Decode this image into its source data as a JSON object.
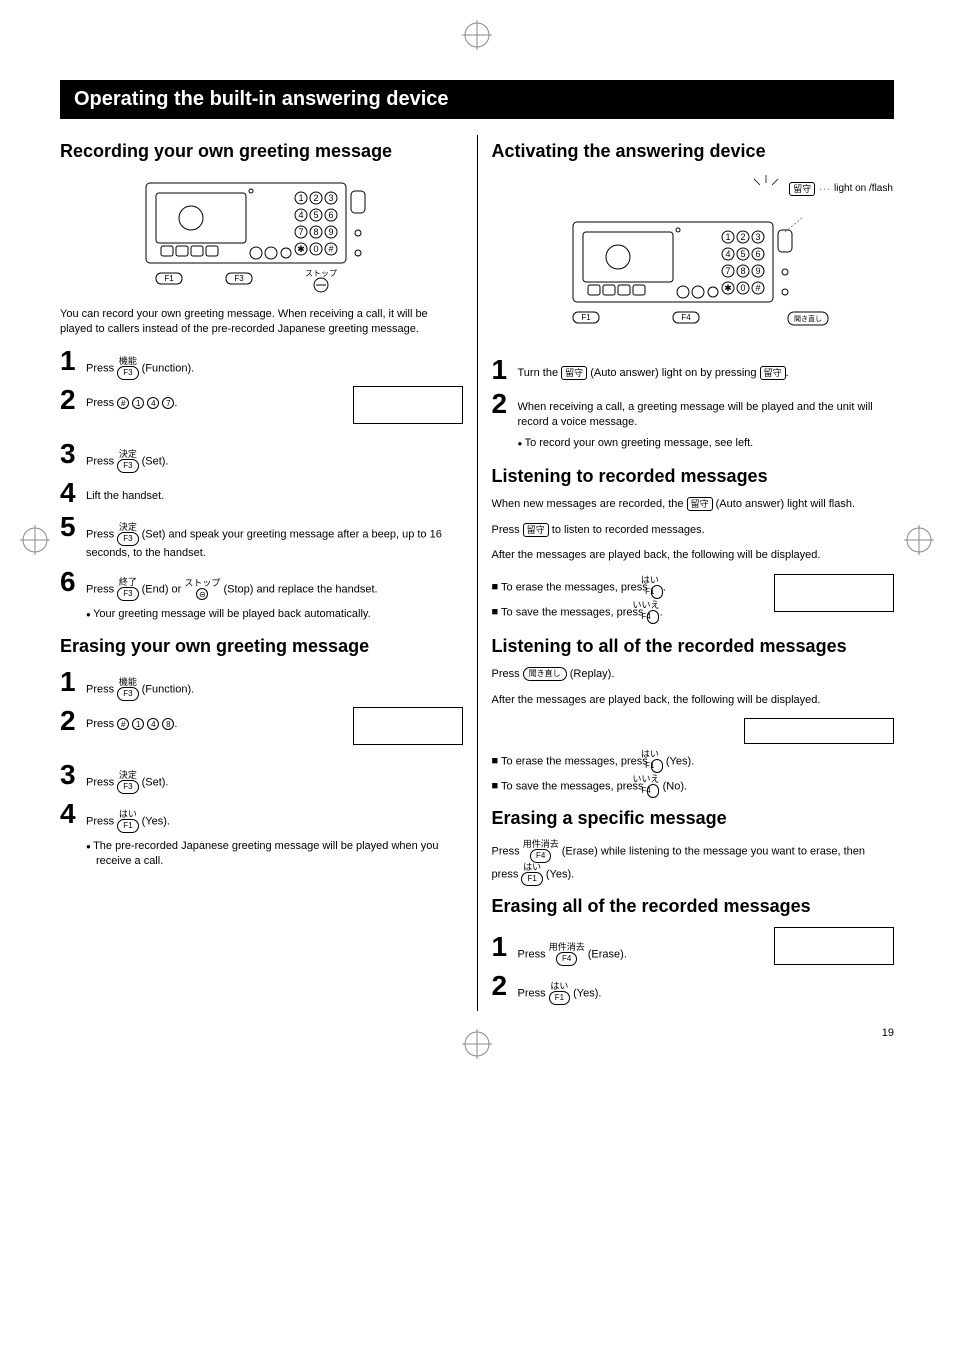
{
  "page_title": "Operating the built-in answering device",
  "page_number": "19",
  "left": {
    "sec1_title": "Recording your own greeting message",
    "sec1_intro": "You can record your own greeting message. When receiving a call, it will be played to callers instead of the pre-recorded Japanese greeting message.",
    "s1_1": "Press",
    "s1_1_key_top": "機能",
    "s1_1_key_bot": "F3",
    "s1_1_after": "(Function).",
    "s1_2": "Press",
    "s1_2_d1": "#",
    "s1_2_d2": "1",
    "s1_2_d3": "4",
    "s1_2_d4": "7",
    "s1_3": "Press",
    "s1_3_key_top": "決定",
    "s1_3_key_bot": "F3",
    "s1_3_after": "(Set).",
    "s1_4": "Lift the handset.",
    "s1_5": "Press",
    "s1_5_key_top": "決定",
    "s1_5_key_bot": "F3",
    "s1_5_after": "(Set) and speak your greeting message after a beep, up to 16 seconds, to the handset.",
    "s1_6": "Press",
    "s1_6_key_top": "終了",
    "s1_6_key_bot": "F3",
    "s1_6_mid": "(End) or",
    "s1_6_stop_top": "ストップ",
    "s1_6_after": "(Stop) and replace the handset.",
    "s1_6_note": "Your greeting message will be played back automatically.",
    "sec2_title": "Erasing your own greeting message",
    "s2_1": "Press",
    "s2_1_key_top": "機能",
    "s2_1_key_bot": "F3",
    "s2_1_after": "(Function).",
    "s2_2": "Press",
    "s2_2_d1": "#",
    "s2_2_d2": "1",
    "s2_2_d3": "4",
    "s2_2_d4": "8",
    "s2_3": "Press",
    "s2_3_key_top": "決定",
    "s2_3_key_bot": "F3",
    "s2_3_after": "(Set).",
    "s2_4": "Press",
    "s2_4_key_top": "はい",
    "s2_4_key_bot": "F1",
    "s2_4_after": "(Yes).",
    "s2_4_note": "The pre-recorded Japanese greeting message will be played when you receive a call."
  },
  "right": {
    "sec1_title": "Activating the answering device",
    "lighton": "light on /flash",
    "rusubtn": "留守",
    "r1_1a": "Turn the",
    "r1_1b": "(Auto answer) light on by pressing",
    "r1_2": "When receiving a call, a greeting message will be played and the unit will record a voice message.",
    "r1_2_note": "To record your own greeting message, see left.",
    "sec2_title": "Listening to recorded messages",
    "sec2_p1a": "When new messages are recorded, the",
    "sec2_p1b": "(Auto answer) light will flash.",
    "sec2_p2a": "Press",
    "sec2_p2b": "to listen to recorded messages.",
    "sec2_p3": "After the messages are played back, the following will be displayed.",
    "sec2_b1": "To erase the messages, press",
    "sec2_b1_top": "はい",
    "sec2_b1_bot": "F1",
    "sec2_b2": "To save the messages, press",
    "sec2_b2_top": "いいえ",
    "sec2_b2_bot": "F4",
    "sec3_title": "Listening to all of the recorded messages",
    "sec3_p1a": "Press",
    "sec3_replay": "聞き直し",
    "sec3_p1b": "(Replay).",
    "sec3_p2": "After the messages are played back, the following will be displayed.",
    "sec3_b1": "To erase the messages, press",
    "sec3_b1_top": "はい",
    "sec3_b1_bot": "F1",
    "sec3_b1_after": "(Yes).",
    "sec3_b2": "To save the messages, press",
    "sec3_b2_top": "いいえ",
    "sec3_b2_bot": "F4",
    "sec3_b2_after": "(No).",
    "sec4_title": "Erasing a specific message",
    "sec4_p1a": "Press",
    "sec4_p1_top": "用件消去",
    "sec4_p1_bot": "F4",
    "sec4_p1b": "(Erase) while listening to the message you want to erase, then press",
    "sec4_p1_top2": "はい",
    "sec4_p1_bot2": "F1",
    "sec4_p1c": "(Yes).",
    "sec5_title": "Erasing all of the recorded messages",
    "s5_1": "Press",
    "s5_1_top": "用件消去",
    "s5_1_bot": "F4",
    "s5_1_after": "(Erase).",
    "s5_2": "Press",
    "s5_2_top": "はい",
    "s5_2_bot": "F1",
    "s5_2_after": "(Yes)."
  }
}
